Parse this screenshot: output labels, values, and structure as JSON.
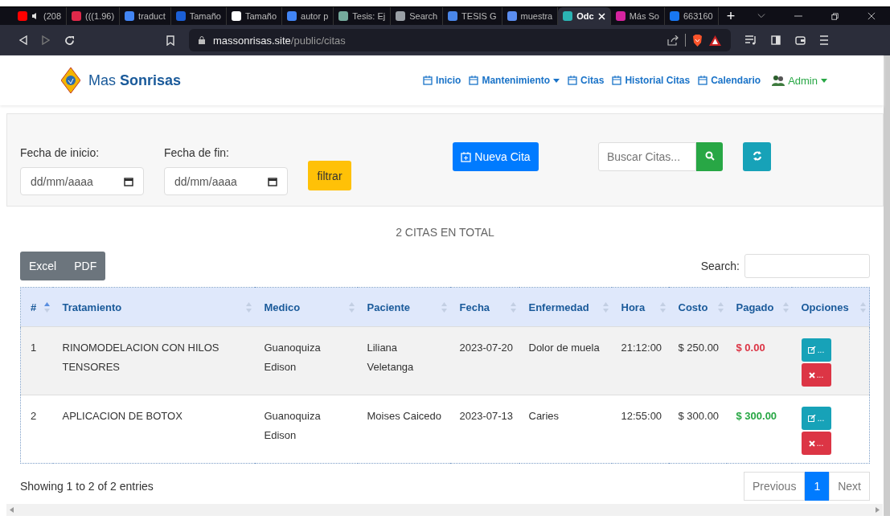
{
  "browser": {
    "tabs": [
      {
        "label": "(208",
        "color": "#ff0000",
        "muted": true,
        "selected": false
      },
      {
        "label": "(((1.96)",
        "color": "#e0294a",
        "muted": false,
        "selected": false
      },
      {
        "label": "traduct",
        "color": "#4285f4",
        "muted": false,
        "selected": false
      },
      {
        "label": "Tamaño",
        "color": "#1b5fd6",
        "muted": false,
        "selected": false
      },
      {
        "label": "Tamaño",
        "color": "#ffffff",
        "muted": false,
        "selected": false
      },
      {
        "label": "autor p",
        "color": "#4285f4",
        "muted": false,
        "selected": false
      },
      {
        "label": "Tesis: Ej",
        "color": "#74aa9c",
        "muted": false,
        "selected": false
      },
      {
        "label": "Search",
        "color": "#9aa0a6",
        "muted": false,
        "selected": false
      },
      {
        "label": "TESIS G",
        "color": "#4a86e8",
        "muted": false,
        "selected": false
      },
      {
        "label": "muestra",
        "color": "#5b8def",
        "muted": false,
        "selected": false
      },
      {
        "label": "Odc",
        "color": "#2bb3b3",
        "muted": false,
        "selected": true
      },
      {
        "label": "Más So",
        "color": "#d6249f",
        "muted": false,
        "selected": false
      },
      {
        "label": "663160",
        "color": "#1877f2",
        "muted": false,
        "selected": false
      }
    ],
    "new_tab": "+",
    "url_host": "massonrisas.site",
    "url_path": "/public/citas"
  },
  "navbar": {
    "brand": "Mas **Sonrisas**",
    "items": [
      {
        "label": "Inicio",
        "dropdown": false
      },
      {
        "label": "Mantenimiento",
        "dropdown": true
      },
      {
        "label": "Citas",
        "dropdown": false
      },
      {
        "label": "Historial Citas",
        "dropdown": false
      },
      {
        "label": "Calendario",
        "dropdown": false
      }
    ],
    "user": "Admin"
  },
  "filters": {
    "start_label": "Fecha de inicio:",
    "start_placeholder": "dd/mm/aaaa",
    "end_label": "Fecha de fin:",
    "end_placeholder": "dd/mm/aaaa",
    "filter_button": "filtrar",
    "new_button": "Nueva Cita",
    "search_placeholder": "Buscar Citas..."
  },
  "summary": "2 CITAS EN TOTAL",
  "export_buttons": [
    "Excel",
    "PDF"
  ],
  "search_label": "Search:",
  "table": {
    "columns": [
      {
        "label": "#",
        "sorted": true
      },
      {
        "label": "Tratamiento",
        "sorted": false
      },
      {
        "label": "Medico",
        "sorted": false
      },
      {
        "label": "Paciente",
        "sorted": false
      },
      {
        "label": "Fecha",
        "sorted": false
      },
      {
        "label": "Enfermedad",
        "sorted": false
      },
      {
        "label": "Hora",
        "sorted": false
      },
      {
        "label": "Costo",
        "sorted": false
      },
      {
        "label": "Pagado",
        "sorted": false
      },
      {
        "label": "Opciones",
        "sorted": false
      }
    ],
    "rows": [
      {
        "num": "1",
        "tratamiento": "RINOMODELACION CON HILOS TENSORES",
        "medico": "Guanoquiza Edison",
        "paciente": "Liliana Veletanga",
        "fecha": "2023-07-20",
        "enfermedad": "Dolor de muela",
        "hora": "21:12:00",
        "costo": "$ 250.00",
        "pagado": "$ 0.00",
        "paid": false,
        "edit": "...",
        "delete": "..."
      },
      {
        "num": "2",
        "tratamiento": "APLICACION DE BOTOX",
        "medico": "Guanoquiza Edison",
        "paciente": "Moises Caicedo",
        "fecha": "2023-07-13",
        "enfermedad": "Caries",
        "hora": "12:55:00",
        "costo": "$ 300.00",
        "pagado": "$ 300.00",
        "paid": true,
        "edit": "...",
        "delete": "..."
      }
    ]
  },
  "info": "Showing 1 to 2 of 2 entries",
  "pagination": [
    {
      "label": "Previous",
      "selected": false
    },
    {
      "label": "1",
      "selected": true
    },
    {
      "label": "Next",
      "selected": false
    }
  ]
}
